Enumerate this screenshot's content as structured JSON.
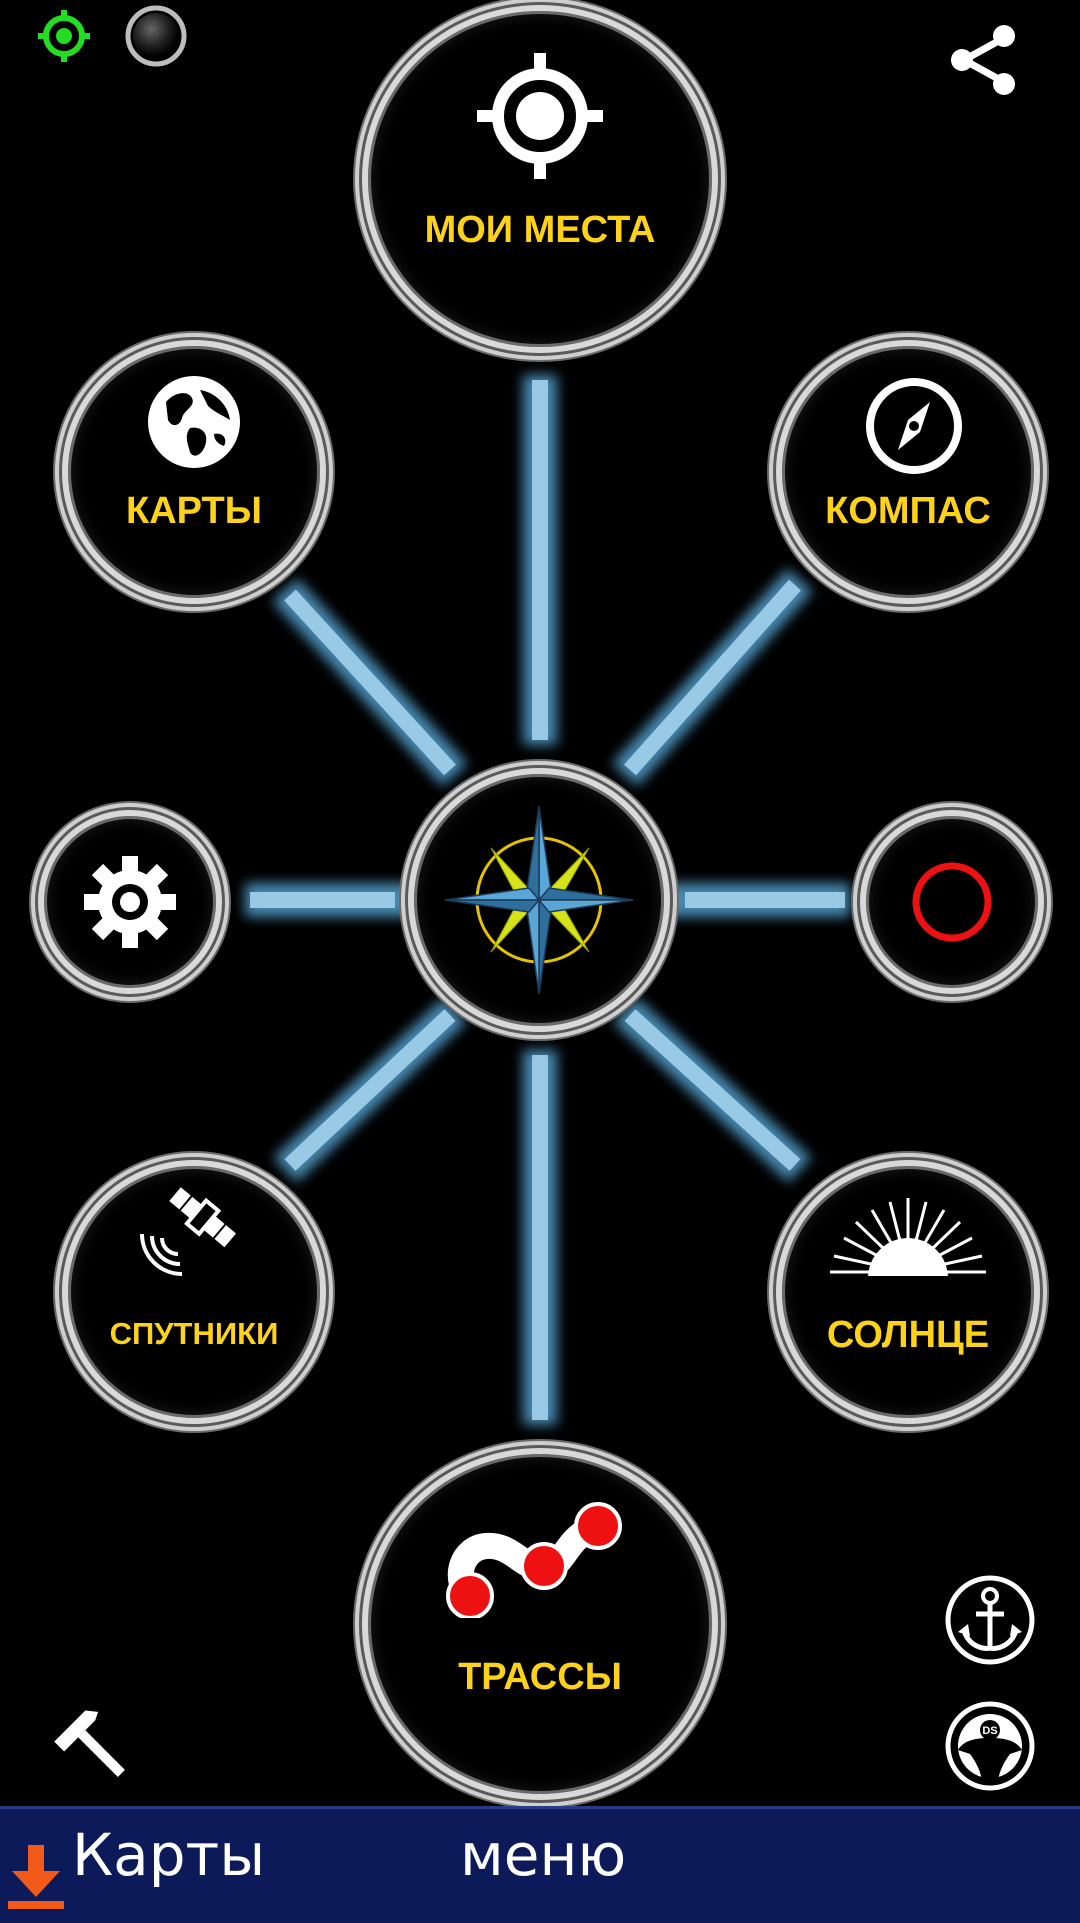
{
  "hubs": {
    "my_places": {
      "label": "МОИ МЕСТА",
      "icon": "crosshair-icon"
    },
    "maps": {
      "label": "КАРТЫ",
      "icon": "globe-icon"
    },
    "compass": {
      "label": "КОМПАС",
      "icon": "compass-icon"
    },
    "settings": {
      "label": "",
      "icon": "gear-icon"
    },
    "record": {
      "label": "",
      "icon": "record-circle-icon"
    },
    "satellites": {
      "label": "СПУТНИКИ",
      "icon": "satellite-icon"
    },
    "sun": {
      "label": "СОЛНЦЕ",
      "icon": "sunrise-icon"
    },
    "tracks": {
      "label": "ТРАССЫ",
      "icon": "track-route-icon"
    },
    "center": {
      "label": "",
      "icon": "compass-rose-icon"
    }
  },
  "top_bar": {
    "gps_icon": "gps-status-icon",
    "gps_color": "#22dd22",
    "record_indicator_icon": "indicator-dot-icon",
    "share_icon": "share-icon"
  },
  "corner_icons": {
    "hammer": "hammer-icon",
    "anchor": "anchor-icon",
    "steering": "steering-wheel-icon",
    "steering_badge": "DS"
  },
  "bottom_bar": {
    "download_icon": "download-icon",
    "maps_label": "Карты",
    "menu_label": "меню"
  },
  "colors": {
    "label": "#ffd21a",
    "spoke": "#6fb3d8",
    "bar": "#0c1a5a",
    "record": "#ee1111",
    "download": "#f25a1a"
  }
}
